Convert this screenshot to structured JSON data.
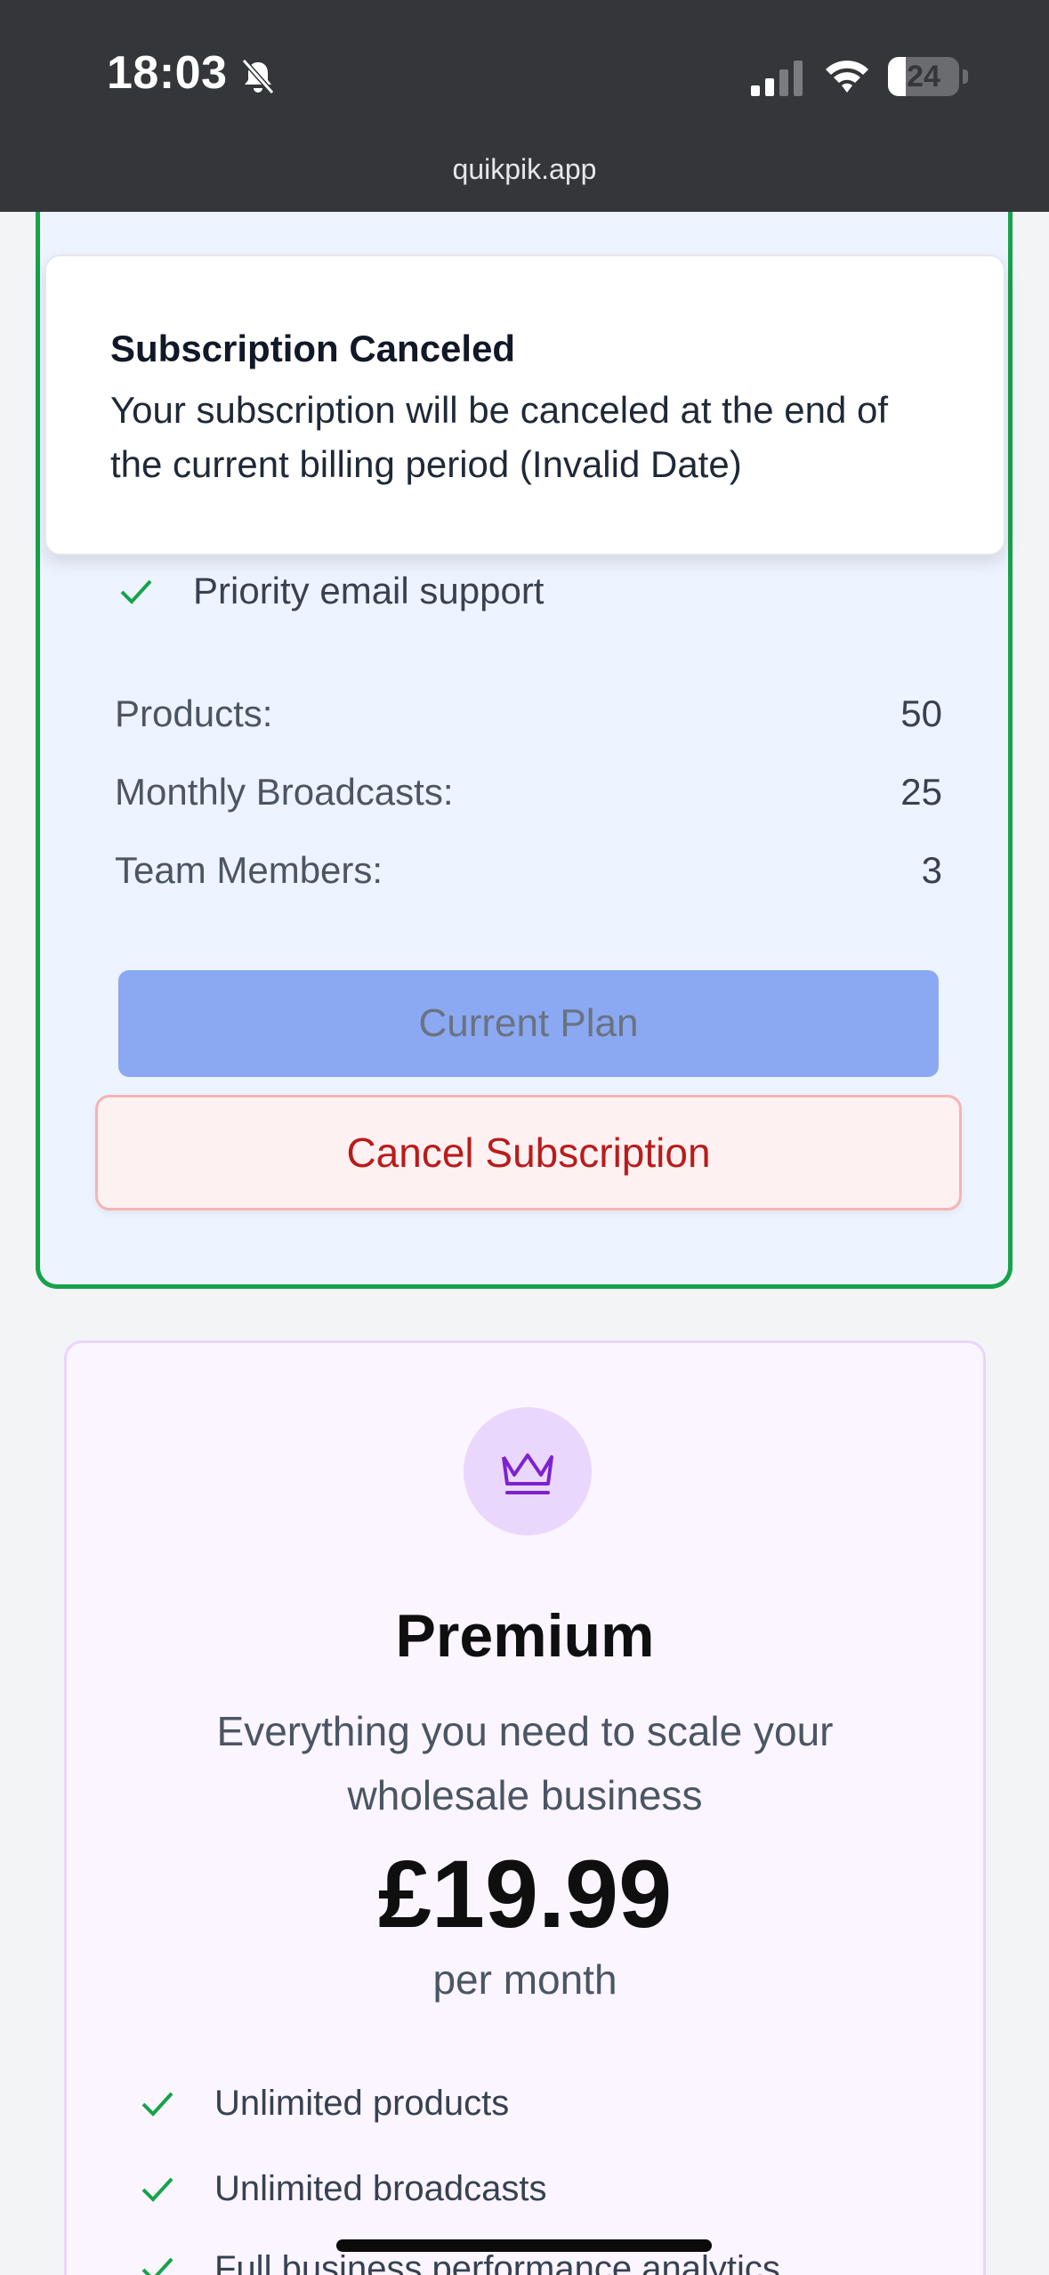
{
  "status_bar": {
    "time": "18:03",
    "battery": "24",
    "url": "quikpik.app"
  },
  "toast": {
    "title": "Subscription Canceled",
    "message": "Your subscription will be canceled at the end of the current billing period (Invalid Date)"
  },
  "current_plan": {
    "features": [
      "Priority email support"
    ],
    "limits": [
      {
        "label": "Products:",
        "value": "50"
      },
      {
        "label": "Monthly Broadcasts:",
        "value": "25"
      },
      {
        "label": "Team Members:",
        "value": "3"
      }
    ],
    "current_plan_label": "Current Plan",
    "cancel_label": "Cancel Subscription"
  },
  "premium": {
    "icon": "crown-icon",
    "name": "Premium",
    "description": "Everything you need to scale your wholesale business",
    "price": "£19.99",
    "period": "per month",
    "features": [
      "Unlimited products",
      "Unlimited broadcasts",
      "Full business performance analytics"
    ]
  },
  "colors": {
    "accent_green": "#16a34a",
    "cancel_red": "#b91c1c",
    "premium_purple": "#7e22ce"
  }
}
